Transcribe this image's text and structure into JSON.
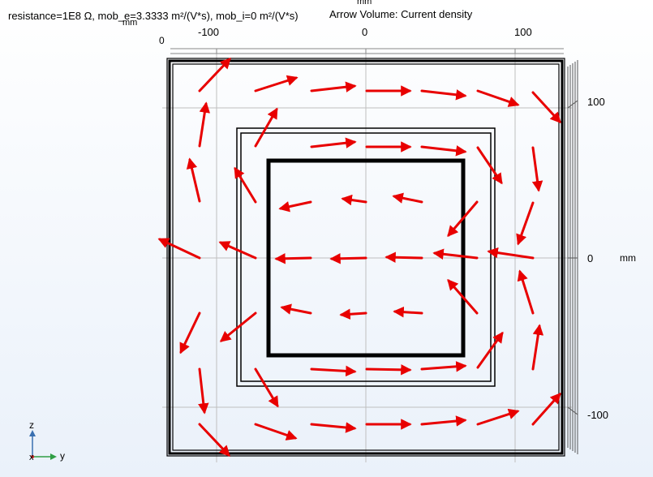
{
  "plot": {
    "title_left": "resistance=1E8 Ω, mob_e=3.3333 m²/(V*s), mob_i=0 m²/(V*s)",
    "title_right": "Arrow Volume: Current density",
    "top_axis_unit": "mm",
    "top_axis_label": "mm",
    "right_axis_unit": "mm",
    "top_ticks": [
      "-100",
      "0",
      "100"
    ],
    "left_zero": "0",
    "right_ticks": [
      "100",
      "0",
      "-100"
    ]
  },
  "triad": {
    "z": "z",
    "y": "y",
    "x": "x"
  },
  "colors": {
    "arrow": "#e80000",
    "grid": "#bfbfbf",
    "frame": "#000000"
  }
}
